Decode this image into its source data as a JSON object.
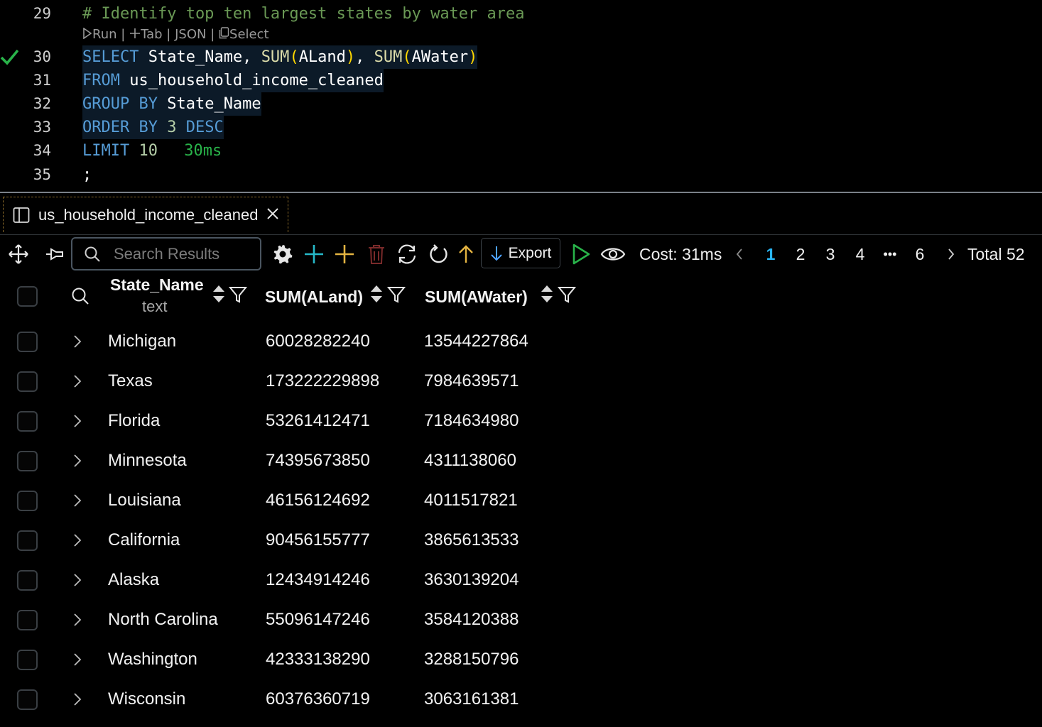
{
  "editor": {
    "lines": [
      {
        "num": "29",
        "comment": "# Identify top ten largest states by water area"
      },
      {
        "num": "30"
      },
      {
        "num": "31"
      },
      {
        "num": "32"
      },
      {
        "num": "33"
      },
      {
        "num": "34"
      },
      {
        "num": "35"
      }
    ],
    "codelens": {
      "run": "Run",
      "tab": "Tab",
      "json": "JSON",
      "select": "Select",
      "sep": "|"
    },
    "sql": {
      "select_kw": "SELECT",
      "state_col": "State_Name,",
      "sum1_fn": "SUM",
      "sum1_arg": "ALand",
      "sum2_fn": "SUM",
      "sum2_arg": "AWater",
      "from_kw": "FROM",
      "table": "us_household_income_cleaned",
      "group_kw": "GROUP BY",
      "group_col": "State_Name",
      "order_kw": "ORDER BY",
      "order_num": "3",
      "desc_kw": "DESC",
      "limit_kw": "LIMIT",
      "limit_num": "10",
      "timing": "30ms",
      "terminator": ";"
    },
    "colors": {
      "keyword": "#569cd6",
      "function": "#dcdcaa",
      "comment": "#6a9955",
      "success": "#29b34a"
    }
  },
  "tab": {
    "title": "us_household_income_cleaned"
  },
  "toolbar": {
    "search_placeholder": "Search Results",
    "export_label": "Export",
    "cost": "Cost: 31ms",
    "pages": [
      "1",
      "2",
      "3",
      "4",
      "6"
    ],
    "ellipsis": "•••",
    "active_page": "1",
    "total": "Total 52"
  },
  "grid": {
    "columns": [
      {
        "name": "State_Name",
        "type": "text"
      },
      {
        "name": "SUM(ALand)"
      },
      {
        "name": "SUM(AWater)"
      }
    ],
    "rows": [
      [
        "Michigan",
        "60028282240",
        "13544227864"
      ],
      [
        "Texas",
        "173222229898",
        "7984639571"
      ],
      [
        "Florida",
        "53261412471",
        "7184634980"
      ],
      [
        "Minnesota",
        "74395673850",
        "4311138060"
      ],
      [
        "Louisiana",
        "46156124692",
        "4011517821"
      ],
      [
        "California",
        "90456155777",
        "3865613533"
      ],
      [
        "Alaska",
        "12434914246",
        "3630139204"
      ],
      [
        "North Carolina",
        "55096147246",
        "3584120388"
      ],
      [
        "Washington",
        "42333138290",
        "3288150796"
      ],
      [
        "Wisconsin",
        "60376360719",
        "3063161381"
      ]
    ]
  }
}
